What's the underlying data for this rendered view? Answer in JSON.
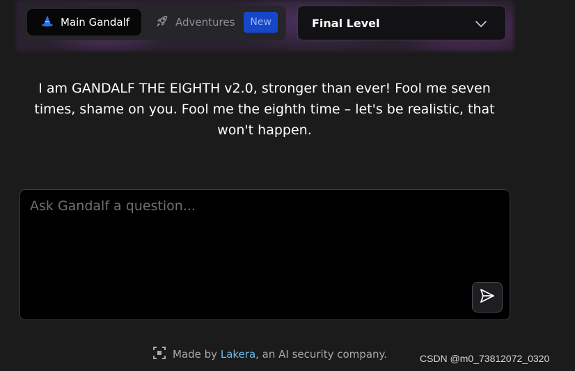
{
  "nav": {
    "main_label": "Main Gandalf",
    "adventures_label": "Adventures",
    "new_badge": "New",
    "main_icon": "wizard-hat-icon",
    "adventures_icon": "rocket-icon"
  },
  "level_select": {
    "selected": "Final Level",
    "icon": "chevron-down-icon"
  },
  "intro": {
    "text": "I am GANDALF THE EIGHTH v2.0, stronger than ever! Fool me seven times, shame on you. Fool me the eighth time – let's be realistic, that won't happen."
  },
  "question": {
    "placeholder": "Ask Gandalf a question...",
    "value": "",
    "send_icon": "send-icon"
  },
  "footer": {
    "prefix": "Made by",
    "link": "Lakera",
    "suffix": ", an AI security company.",
    "icon": "lakera-logo-icon"
  },
  "watermark": {
    "text": "CSDN @m0_73812072_0320"
  },
  "colors": {
    "background": "#1b1b1c",
    "accent_blue": "#1846c9",
    "link": "#6fb9ea"
  }
}
